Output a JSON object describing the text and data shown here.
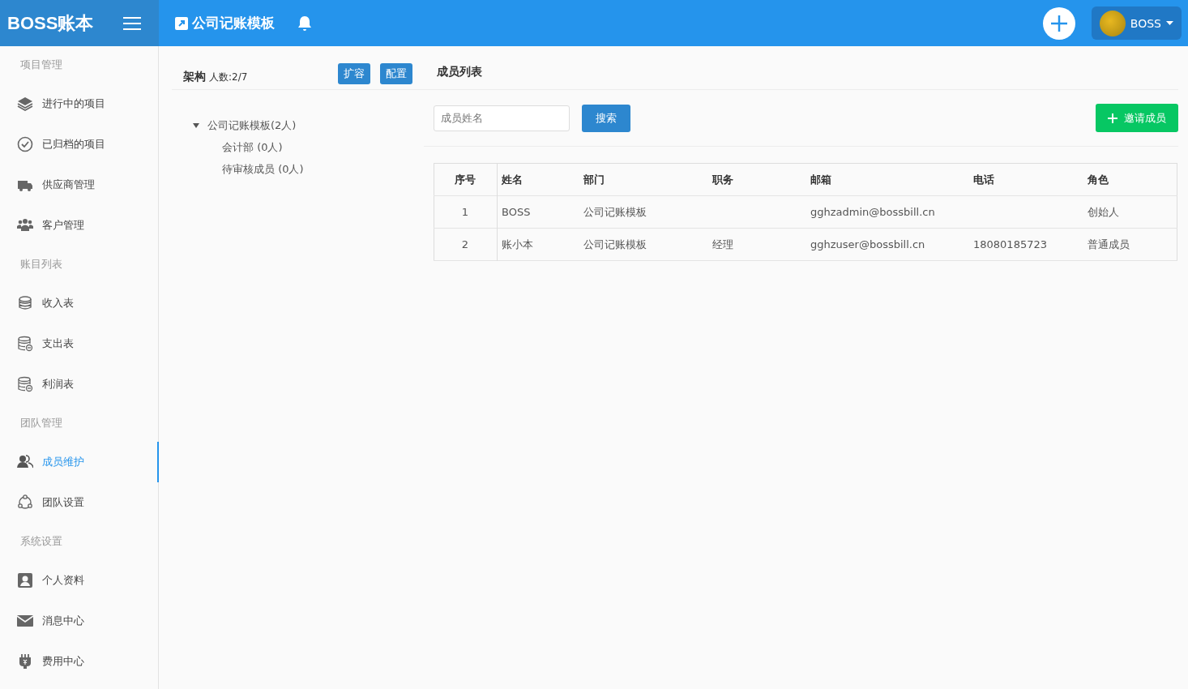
{
  "header": {
    "logo": "BOSS账本",
    "project_title": "公司记账模板",
    "user_name": "BOSS"
  },
  "sidebar": {
    "sections": [
      {
        "title": "项目管理",
        "items": [
          {
            "label": "进行中的项目",
            "selected": false
          },
          {
            "label": "已归档的项目",
            "selected": false
          },
          {
            "label": "供应商管理",
            "selected": false
          },
          {
            "label": "客户管理",
            "selected": false
          }
        ]
      },
      {
        "title": "账目列表",
        "items": [
          {
            "label": "收入表",
            "selected": false
          },
          {
            "label": "支出表",
            "selected": false
          },
          {
            "label": "利润表",
            "selected": false
          }
        ]
      },
      {
        "title": "团队管理",
        "items": [
          {
            "label": "成员维护",
            "selected": true
          },
          {
            "label": "团队设置",
            "selected": false
          }
        ]
      },
      {
        "title": "系统设置",
        "items": [
          {
            "label": "个人资料",
            "selected": false
          },
          {
            "label": "消息中心",
            "selected": false
          },
          {
            "label": "费用中心",
            "selected": false
          }
        ]
      }
    ]
  },
  "structure_panel": {
    "title": "架构",
    "count": "人数:2/7",
    "buttons": [
      "扩容",
      "配置"
    ],
    "tree": [
      {
        "label": "公司记账模板(2人)",
        "expanded": true,
        "children": [
          {
            "label": "会计部 (0人)"
          },
          {
            "label": "待审核成员 (0人)"
          }
        ]
      }
    ]
  },
  "member_panel": {
    "title": "成员列表",
    "search": {
      "placeholder": "成员姓名"
    },
    "search_button": "搜索",
    "invite_button": "邀请成员",
    "table": {
      "columns": [
        "序号",
        "姓名",
        "部门",
        "职务",
        "邮箱",
        "电话",
        "角色"
      ],
      "rows": [
        [
          "1",
          "BOSS",
          "公司记账模板",
          "",
          "gghzadmin@bossbill.cn",
          "",
          "创始人"
        ],
        [
          "2",
          "账小本",
          "公司记账模板",
          "经理",
          "gghzuser@bossbill.cn",
          "18080185723",
          "普通成员"
        ]
      ]
    }
  }
}
